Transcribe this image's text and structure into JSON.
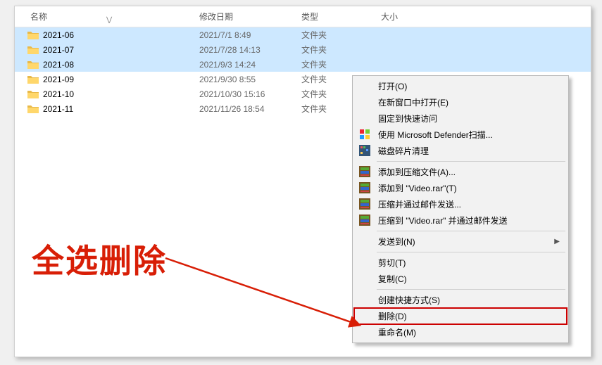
{
  "columns": {
    "name": "名称",
    "date": "修改日期",
    "type": "类型",
    "size": "大小"
  },
  "rows": [
    {
      "name": "2021-06",
      "date": "2021/7/1 8:49",
      "type": "文件夹",
      "selected": true
    },
    {
      "name": "2021-07",
      "date": "2021/7/28 14:13",
      "type": "文件夹",
      "selected": true
    },
    {
      "name": "2021-08",
      "date": "2021/9/3 14:24",
      "type": "文件夹",
      "selected": true
    },
    {
      "name": "2021-09",
      "date": "2021/9/30 8:55",
      "type": "文件夹",
      "selected": false
    },
    {
      "name": "2021-10",
      "date": "2021/10/30 15:16",
      "type": "文件夹",
      "selected": false
    },
    {
      "name": "2021-11",
      "date": "2021/11/26 18:54",
      "type": "文件夹",
      "selected": false
    }
  ],
  "menu": {
    "open": "打开(O)",
    "open_new": "在新窗口中打开(E)",
    "pin_quick": "固定到快速访问",
    "defender": "使用 Microsoft Defender扫描...",
    "defrag": "磁盘碎片清理",
    "add_archive": "添加到压缩文件(A)...",
    "add_video": "添加到 \"Video.rar\"(T)",
    "zip_mail": "压缩并通过邮件发送...",
    "zip_video_mail": "压缩到 \"Video.rar\" 并通过邮件发送",
    "send_to": "发送到(N)",
    "cut": "剪切(T)",
    "copy": "复制(C)",
    "shortcut": "创建快捷方式(S)",
    "delete": "删除(D)",
    "rename": "重命名(M)"
  },
  "annotation": "全选删除"
}
